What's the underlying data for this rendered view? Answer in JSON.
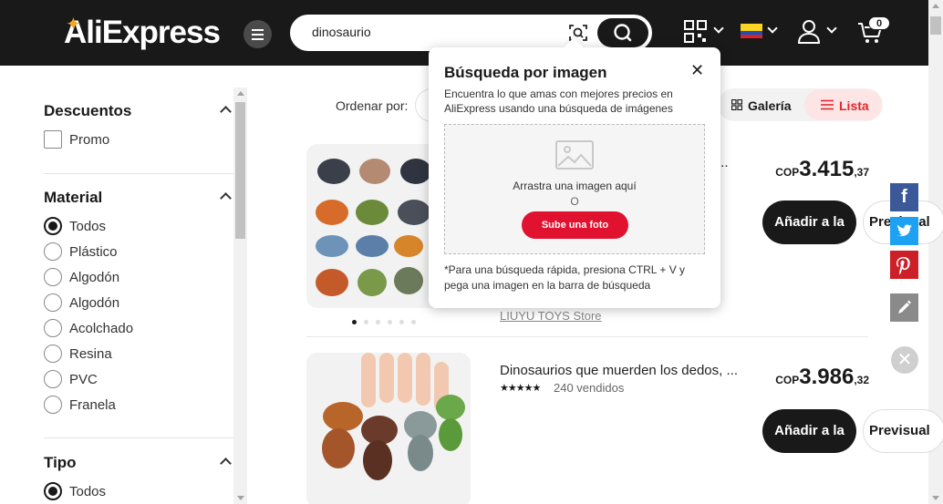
{
  "header": {
    "logo": "AliExpress",
    "search_value": "dinosaurio",
    "cart_count": "0",
    "icons": [
      "menu-icon",
      "camera-search-icon",
      "search-icon",
      "qr-code-icon",
      "flag-colombia-icon",
      "user-icon",
      "cart-icon"
    ]
  },
  "filters": {
    "descuentos": {
      "title": "Descuentos",
      "options": [
        "Promo"
      ]
    },
    "material": {
      "title": "Material",
      "options": [
        "Todos",
        "Plástico",
        "Algodón",
        "Algodón",
        "Acolchado",
        "Resina",
        "PVC",
        "Franela"
      ],
      "selected": "Todos"
    },
    "tipo": {
      "title": "Tipo",
      "options": [
        "Todos"
      ],
      "selected": "Todos"
    }
  },
  "sort": {
    "label": "Ordenar por:",
    "gallery_label": "Galería",
    "list_label": "Lista",
    "active_view": "Lista"
  },
  "products": [
    {
      "title": "...",
      "price_currency": "COP",
      "price_int": "3.415",
      "price_dec": ",37",
      "store": "LIUYU TOYS Store",
      "add_label": "Añadir a la",
      "preview_label": "Previsual"
    },
    {
      "title": "Dinosaurios que muerden los dedos, ...",
      "rating_stars": "★★★★★",
      "sold": "240 vendidos",
      "price_currency": "COP",
      "price_int": "3.986",
      "price_dec": ",32",
      "add_label": "Añadir a la",
      "preview_label": "Previsual"
    }
  ],
  "image_search": {
    "title": "Búsqueda por imagen",
    "description": "Encuentra lo que amas con mejores precios en AliExpress usando una búsqueda de imágenes",
    "drop_text": "Arrastra una imagen aquí",
    "or_text": "O",
    "upload_label": "Sube una foto",
    "hint": "*Para una búsqueda rápida, presiona CTRL + V y pega una imagen en la barra de búsqueda"
  },
  "social": [
    "facebook-icon",
    "twitter-icon",
    "pinterest-icon",
    "edit-icon"
  ],
  "colors": {
    "header_bg": "#191919",
    "accent_red": "#e0282e",
    "upload_red": "#e0122f",
    "list_bg": "#fde5e5"
  }
}
